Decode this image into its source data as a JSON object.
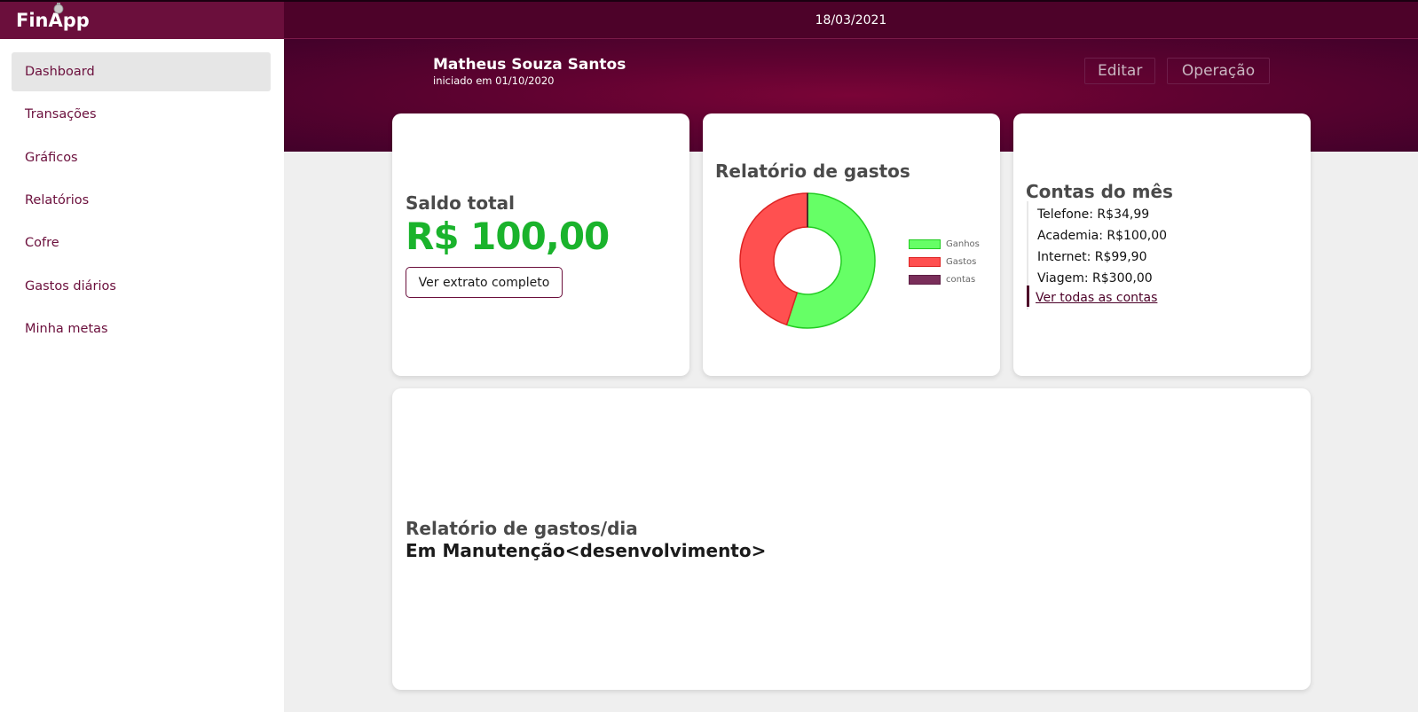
{
  "app": {
    "brand": "FinApp",
    "date": "18/03/2021"
  },
  "sidebar": {
    "items": [
      {
        "label": "Dashboard",
        "active": true
      },
      {
        "label": "Transações"
      },
      {
        "label": "Gráficos"
      },
      {
        "label": "Relatórios"
      },
      {
        "label": "Cofre"
      },
      {
        "label": "Gastos diários"
      },
      {
        "label": "Minha metas"
      }
    ]
  },
  "user": {
    "name": "Matheus Souza Santos",
    "since": "iniciado em 01/10/2020"
  },
  "header": {
    "edit_label": "Editar",
    "operation_label": "Operação"
  },
  "saldo": {
    "title": "Saldo total",
    "value": "R$ 100,00",
    "button_label": "Ver extrato completo"
  },
  "relatorio": {
    "title": "Relatório de gastos",
    "chart_data": {
      "type": "pie",
      "categories": [
        "Ganhos",
        "Gastos",
        "contas"
      ],
      "values": [
        55,
        45,
        0
      ],
      "colors": [
        "#66ff66",
        "#ff5050",
        "#7a2e5a"
      ],
      "legend": "right"
    }
  },
  "contas": {
    "title": "Contas do mês",
    "items": [
      "Telefone: R$34,99",
      "Academia: R$100,00",
      "Internet: R$99,90",
      "Viagem: R$300,00"
    ],
    "link_label": "Ver todas as contas"
  },
  "diario": {
    "title": "Relatório de gastos/dia",
    "status": "Em Manutenção<desenvolvimento>"
  },
  "colors": {
    "brand": "#6b0f3c",
    "topbar": "#4d0229",
    "positive": "#1ab32c"
  }
}
